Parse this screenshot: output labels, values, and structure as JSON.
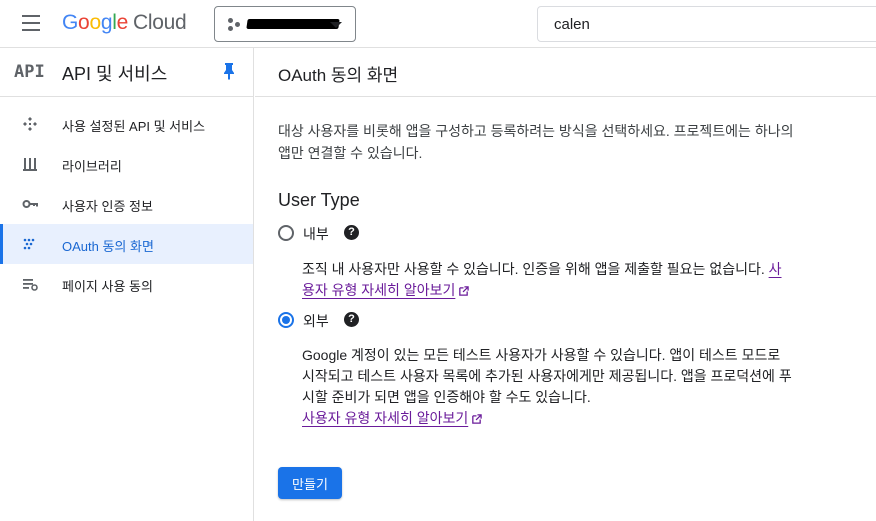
{
  "topbar": {
    "logo_letters": [
      "G",
      "o",
      "o",
      "g",
      "l",
      "e"
    ],
    "logo_cloud": "Cloud",
    "search_value": "calen"
  },
  "sidebar": {
    "api_logo": "API",
    "title": "API 및 서비스",
    "items": [
      {
        "label": "사용 설정된 API 및 서비스",
        "icon": "enabled-apis-icon"
      },
      {
        "label": "라이브러리",
        "icon": "library-icon"
      },
      {
        "label": "사용자 인증 정보",
        "icon": "key-icon"
      },
      {
        "label": "OAuth 동의 화면",
        "icon": "oauth-consent-icon",
        "active": true
      },
      {
        "label": "페이지 사용 동의",
        "icon": "page-usage-icon"
      }
    ]
  },
  "main": {
    "title": "OAuth 동의 화면",
    "intro": "대상 사용자를 비롯해 앱을 구성하고 등록하려는 방식을 선택하세요. 프로젝트에는 하나의 앱만 연결할 수 있습니다.",
    "user_type_heading": "User Type",
    "options": [
      {
        "label": "내부",
        "checked": false,
        "description": "조직 내 사용자만 사용할 수 있습니다. 인증을 위해 앱을 제출할 필요는 없습니다.",
        "link": "사용자 유형 자세히 알아보기"
      },
      {
        "label": "외부",
        "checked": true,
        "description": "Google 계정이 있는 모든 테스트 사용자가 사용할 수 있습니다. 앱이 테스트 모드로 시작되고 테스트 사용자 목록에 추가된 사용자에게만 제공됩니다. 앱을 프로덕션에 푸시할 준비가 되면 앱을 인증해야 할 수도 있습니다.",
        "link": "사용자 유형 자세히 알아보기"
      }
    ],
    "create_button": "만들기"
  },
  "colors": {
    "accent": "#1a73e8",
    "link": "#6a1b9a",
    "active_bg": "#e8f0fe"
  }
}
